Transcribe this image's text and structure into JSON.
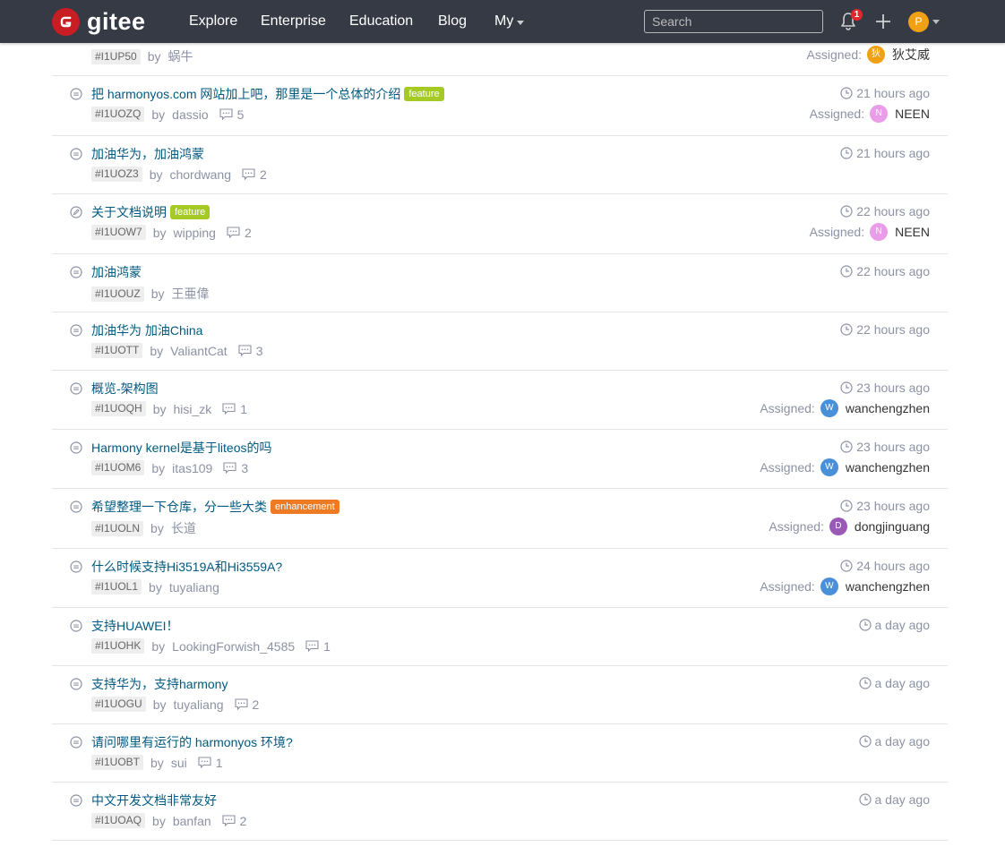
{
  "nav": {
    "brand": "gitee",
    "brand_color": "#c71d23",
    "bar_color": "#363a45",
    "links": [
      "Explore",
      "Enterprise",
      "Education",
      "Blog"
    ],
    "my_label": "My",
    "search_placeholder": "Search",
    "notification_count": "1",
    "user_initial": "P"
  },
  "assigned_label": "Assigned:",
  "by_label": "by",
  "issues": [
    {
      "id": "#I1UP50",
      "title": "",
      "author": "蜗牛",
      "comments": "",
      "time": "",
      "state": "open",
      "label": null,
      "assignee": {
        "name": "狄艾威",
        "initial": "狄",
        "color": "#f0a113"
      }
    },
    {
      "id": "#I1UOZQ",
      "title": "把 harmonyos.com 网站加上吧，那里是一个总体的介绍",
      "author": "dassio",
      "comments": "5",
      "time": "21 hours ago",
      "state": "open",
      "label": {
        "text": "feature",
        "color": "#a5ca26"
      },
      "assignee": {
        "name": "NEEN",
        "initial": "N",
        "color": "#e99ce8"
      }
    },
    {
      "id": "#I1UOZ3",
      "title": "加油华为，加油鸿蒙",
      "author": "chordwang",
      "comments": "2",
      "time": "21 hours ago",
      "state": "open",
      "label": null,
      "assignee": null
    },
    {
      "id": "#I1UOW7",
      "title": "关于文档说明",
      "author": "wipping",
      "comments": "2",
      "time": "22 hours ago",
      "state": "progress",
      "label": {
        "text": "feature",
        "color": "#a5ca26"
      },
      "assignee": {
        "name": "NEEN",
        "initial": "N",
        "color": "#e99ce8"
      }
    },
    {
      "id": "#I1UOUZ",
      "title": "加油鸿蒙",
      "author": "王亜偉",
      "comments": "",
      "time": "22 hours ago",
      "state": "open",
      "label": null,
      "assignee": null
    },
    {
      "id": "#I1UOTT",
      "title": "加油华为 加油China",
      "author": "ValiantCat",
      "comments": "3",
      "time": "22 hours ago",
      "state": "open",
      "label": null,
      "assignee": null
    },
    {
      "id": "#I1UOQH",
      "title": "概览-架构图",
      "author": "hisi_zk",
      "comments": "1",
      "time": "23 hours ago",
      "state": "open",
      "label": null,
      "assignee": {
        "name": "wanchengzhen",
        "initial": "W",
        "color": "#4a90d9"
      }
    },
    {
      "id": "#I1UOM6",
      "title": "Harmony kernel是基于liteos的吗",
      "author": "itas109",
      "comments": "3",
      "time": "23 hours ago",
      "state": "open",
      "label": null,
      "assignee": {
        "name": "wanchengzhen",
        "initial": "W",
        "color": "#4a90d9"
      }
    },
    {
      "id": "#I1UOLN",
      "title": "希望整理一下仓库，分一些大类",
      "author": "长道",
      "comments": "",
      "time": "23 hours ago",
      "state": "open",
      "label": {
        "text": "enhancement",
        "color": "#ee7b23"
      },
      "assignee": {
        "name": "dongjinguang",
        "initial": "D",
        "color": "#9b59b6"
      }
    },
    {
      "id": "#I1UOL1",
      "title": "什么时候支持Hi3519A和Hi3559A?",
      "author": "tuyaliang",
      "comments": "",
      "time": "24 hours ago",
      "state": "open",
      "label": null,
      "assignee": {
        "name": "wanchengzhen",
        "initial": "W",
        "color": "#4a90d9"
      }
    },
    {
      "id": "#I1UOHK",
      "title": "支持HUAWEI！",
      "author": "LookingForwish_4585",
      "comments": "1",
      "time": "a day ago",
      "state": "open",
      "label": null,
      "assignee": null
    },
    {
      "id": "#I1UOGU",
      "title": "支持华为，支持harmony",
      "author": "tuyaliang",
      "comments": "2",
      "time": "a day ago",
      "state": "open",
      "label": null,
      "assignee": null
    },
    {
      "id": "#I1UOBT",
      "title": "请问哪里有运行的 harmonyos 环境?",
      "author": "sui",
      "comments": "1",
      "time": "a day ago",
      "state": "open",
      "label": null,
      "assignee": null
    },
    {
      "id": "#I1UOAQ",
      "title": "中文开发文档非常友好",
      "author": "banfan",
      "comments": "2",
      "time": "a day ago",
      "state": "open",
      "label": null,
      "assignee": null
    }
  ]
}
